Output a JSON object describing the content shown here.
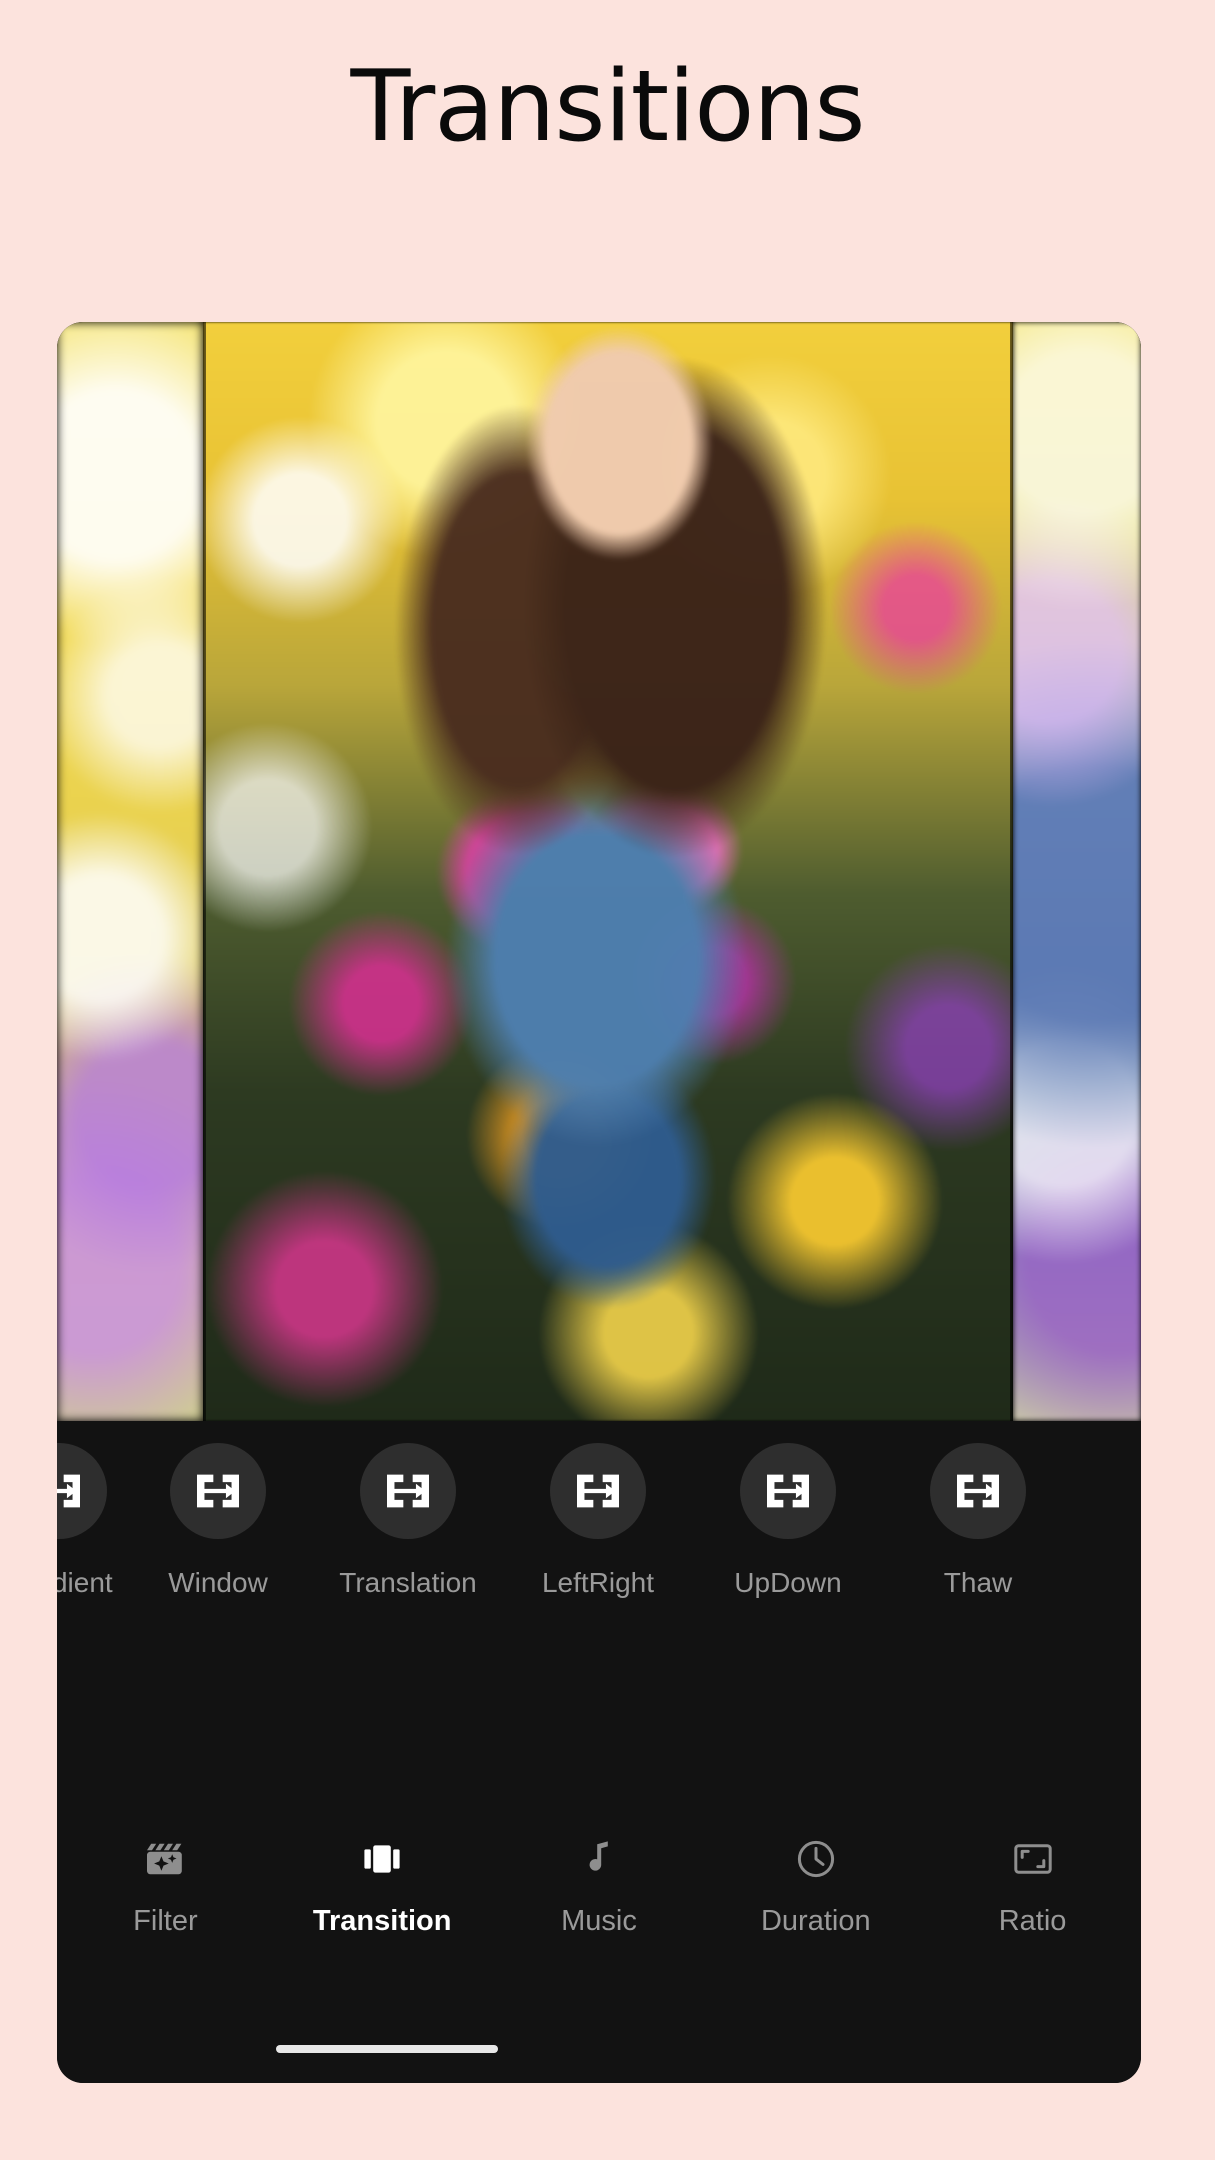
{
  "page": {
    "title": "Transitions",
    "background_color": "#fce3dd"
  },
  "preview": {
    "name": "video-preview-carousel",
    "slides": [
      {
        "id": "prev-slide",
        "description": "blurred yellow wildflower field"
      },
      {
        "id": "current-slide",
        "description": "woman in floral dress standing in wildflower field"
      },
      {
        "id": "next-slide",
        "description": "blurred denim and flowers"
      }
    ]
  },
  "transitions": {
    "name": "transitions-strip",
    "icon": "transition-swap-icon",
    "items": [
      {
        "label": "Gradient",
        "selected": false
      },
      {
        "label": "Window",
        "selected": false
      },
      {
        "label": "Translation",
        "selected": false
      },
      {
        "label": "LeftRight",
        "selected": false
      },
      {
        "label": "UpDown",
        "selected": false
      },
      {
        "label": "Thaw",
        "selected": false
      }
    ]
  },
  "tabbar": {
    "name": "editor-tab-bar",
    "active": "Transition",
    "tabs": [
      {
        "label": "Filter",
        "icon": "clapperboard-sparkle-icon",
        "active": false
      },
      {
        "label": "Transition",
        "icon": "transition-cards-icon",
        "active": true
      },
      {
        "label": "Music",
        "icon": "music-note-icon",
        "active": false
      },
      {
        "label": "Duration",
        "icon": "clock-icon",
        "active": false
      },
      {
        "label": "Ratio",
        "icon": "aspect-ratio-icon",
        "active": false
      }
    ]
  },
  "colors": {
    "page_bg": "#fce3dd",
    "panel_bg": "#121212",
    "circle_bg": "#2e2e2e",
    "inactive_text": "#9a9a9a",
    "active_text": "#ffffff"
  }
}
